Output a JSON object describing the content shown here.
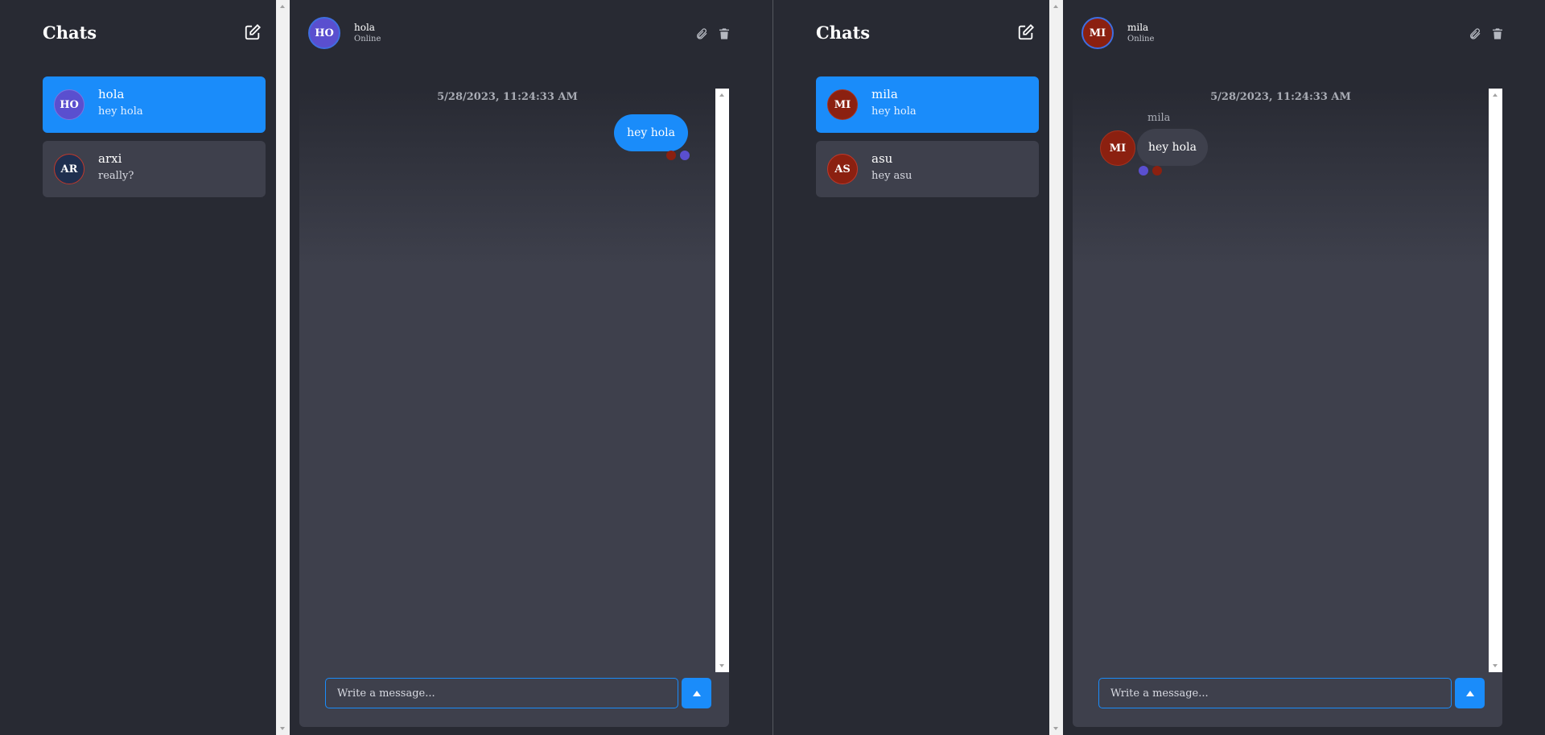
{
  "panes": [
    {
      "sidebar": {
        "title": "Chats",
        "chats": [
          {
            "initials": "HO",
            "name": "hola",
            "preview": "hey hola",
            "active": true
          },
          {
            "initials": "AR",
            "name": "arxi",
            "preview": "really?",
            "active": false
          }
        ]
      },
      "header": {
        "initials": "HO",
        "name": "hola",
        "status": "Online"
      },
      "messages": {
        "timestamp": "5/28/2023, 11:24:33 AM",
        "items": [
          {
            "text": "hey hola",
            "direction": "outgoing"
          }
        ]
      },
      "composer": {
        "placeholder": "Write a message..."
      }
    },
    {
      "sidebar": {
        "title": "Chats",
        "chats": [
          {
            "initials": "MI",
            "name": "mila",
            "preview": "hey hola",
            "active": true
          },
          {
            "initials": "AS",
            "name": "asu",
            "preview": "hey asu",
            "active": false
          }
        ]
      },
      "header": {
        "initials": "MI",
        "name": "mila",
        "status": "Online"
      },
      "messages": {
        "timestamp": "5/28/2023, 11:24:33 AM",
        "items": [
          {
            "sender": "mila",
            "sender_initials": "MI",
            "text": "hey hola",
            "direction": "incoming"
          }
        ]
      },
      "composer": {
        "placeholder": "Write a message..."
      }
    }
  ],
  "colors": {
    "accent": "#1a8cfa",
    "background": "#282a33",
    "panel": "#3e404c",
    "avatar_purple": "#5a4fcf",
    "avatar_red": "#8b2010"
  },
  "icons": {
    "compose": "edit-icon",
    "attach": "paperclip-icon",
    "delete": "trash-icon",
    "send": "arrow-up-icon"
  }
}
